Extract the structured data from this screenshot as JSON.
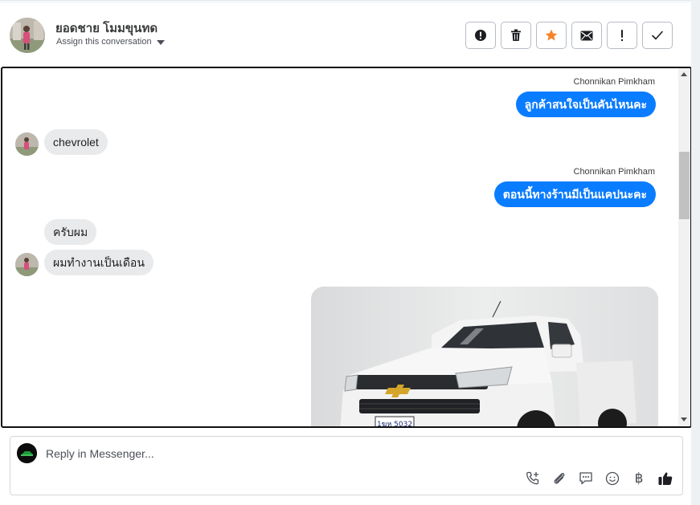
{
  "header": {
    "contact_name": "ยอดชาย โมมขุนทด",
    "assign_label": "Assign this conversation",
    "actions": [
      {
        "icon": "exclamation-circle-icon"
      },
      {
        "icon": "trash-icon"
      },
      {
        "icon": "star-icon",
        "color": "#f5832a"
      },
      {
        "icon": "envelope-icon"
      },
      {
        "icon": "exclamation-icon"
      },
      {
        "icon": "check-icon"
      }
    ]
  },
  "messages": [
    {
      "direction": "outgoing",
      "sender": "Chonnikan Pimkham",
      "text": "ลูกค้าสนใจเป็นคันไหนคะ"
    },
    {
      "direction": "incoming",
      "text": "chevrolet"
    },
    {
      "direction": "outgoing",
      "sender": "Chonnikan Pimkham",
      "text": "ตอนนี้ทางร้านมีเป็นแคปนะคะ"
    },
    {
      "direction": "incoming",
      "text": "ครับผม"
    },
    {
      "direction": "incoming",
      "text": "ผมทำงานเป็นเดือน"
    },
    {
      "direction": "outgoing",
      "type": "image",
      "plate_text": "1ฆห 5032"
    }
  ],
  "reply": {
    "placeholder": "Reply in Messenger...",
    "tools": [
      "phone-plus-icon",
      "paperclip-icon",
      "chat-bubble-icon",
      "smiley-icon",
      "baht-icon",
      "thumbs-up-icon"
    ],
    "baht_symbol": "฿"
  },
  "colors": {
    "outgoing_bubble": "#0a7cff",
    "incoming_bubble": "#e9eaeb",
    "star": "#f5832a"
  }
}
